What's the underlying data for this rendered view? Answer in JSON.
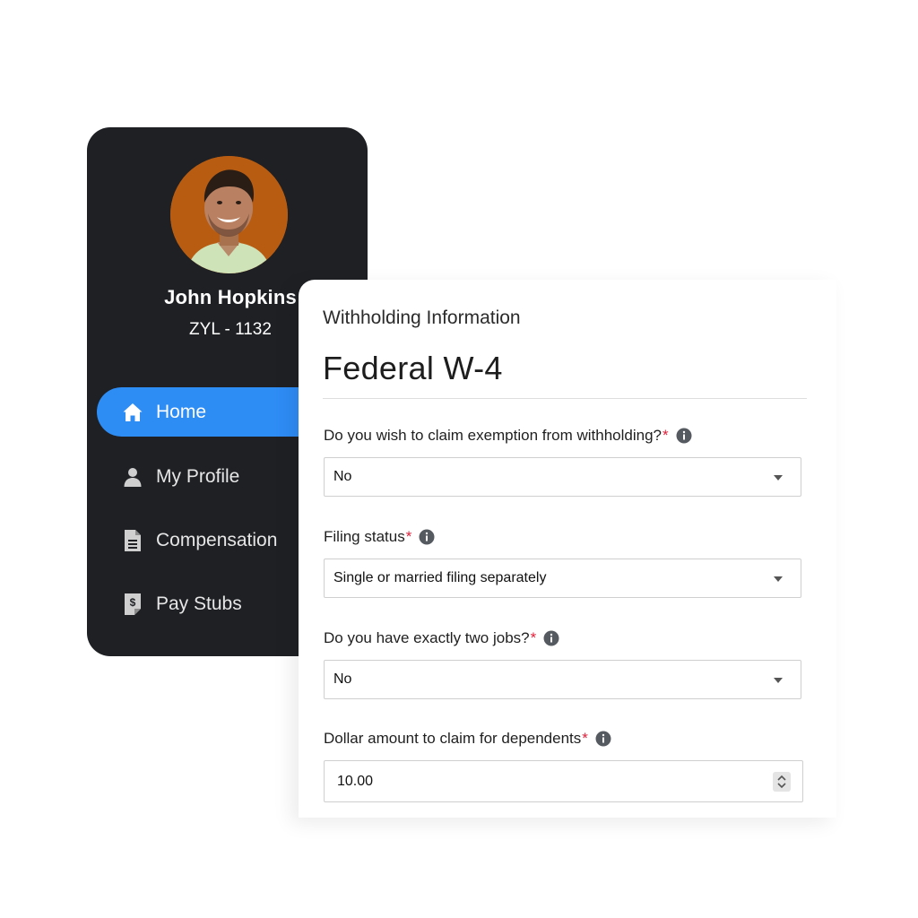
{
  "profile": {
    "name": "John Hopkins",
    "employee_id": "ZYL - 1132",
    "avatar_bg": "#b85c12"
  },
  "nav": {
    "accent": "#2e8cf5",
    "items": [
      {
        "label": "Home",
        "icon": "home-icon",
        "active": true
      },
      {
        "label": "My Profile",
        "icon": "user-icon",
        "active": false
      },
      {
        "label": "Compensation",
        "icon": "document-icon",
        "active": false
      },
      {
        "label": "Pay Stubs",
        "icon": "pay-stub-icon",
        "active": false
      }
    ]
  },
  "form": {
    "section_label": "Withholding Information",
    "title": "Federal W-4",
    "required_marker": "*",
    "required_color": "#e0203a",
    "fields": [
      {
        "label": "Do you wish to claim exemption from withholding?",
        "value": "No",
        "type": "select"
      },
      {
        "label": "Filing status",
        "value": "Single or married filing separately",
        "type": "select"
      },
      {
        "label": "Do you have exactly two jobs?",
        "value": "No",
        "type": "select"
      },
      {
        "label": "Dollar amount to claim for dependents",
        "value": "10.00",
        "type": "number"
      }
    ]
  }
}
